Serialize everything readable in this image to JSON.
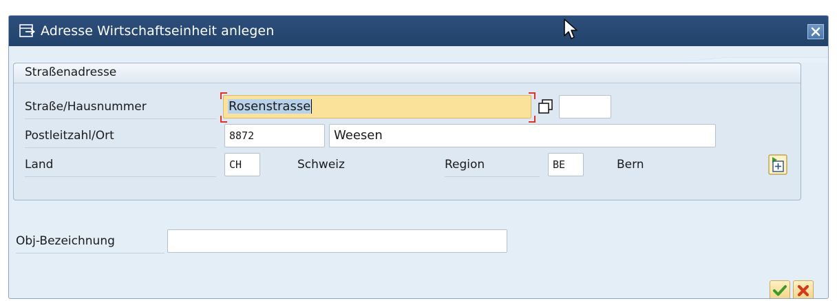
{
  "dialog": {
    "title": "Adresse Wirtschaftseinheit anlegen",
    "title_icon": "create-dialog-icon",
    "close_icon": "close-icon"
  },
  "group": {
    "title": "Straßenadresse"
  },
  "fields": {
    "street": {
      "label": "Straße/Hausnummer",
      "value": "Rosenstrasse",
      "house_number": ""
    },
    "postal": {
      "label": "Postleitzahl/Ort",
      "postcode": "8872",
      "city": "Weesen"
    },
    "country": {
      "label": "Land",
      "code": "CH",
      "name": "Schweiz"
    },
    "region": {
      "label": "Region",
      "code": "BE",
      "name": "Bern"
    },
    "object": {
      "label": "Obj-Bezeichnung",
      "value": ""
    }
  },
  "icons": {
    "copy": "copy-icon",
    "more_address": "more-address-fields-icon",
    "confirm": "checkmark-icon",
    "cancel": "cancel-x-icon"
  },
  "colors": {
    "titlebar": "#22426b",
    "focused_field": "#fae29a",
    "confirm": "#3c9a28",
    "cancel": "#d33a1a"
  }
}
